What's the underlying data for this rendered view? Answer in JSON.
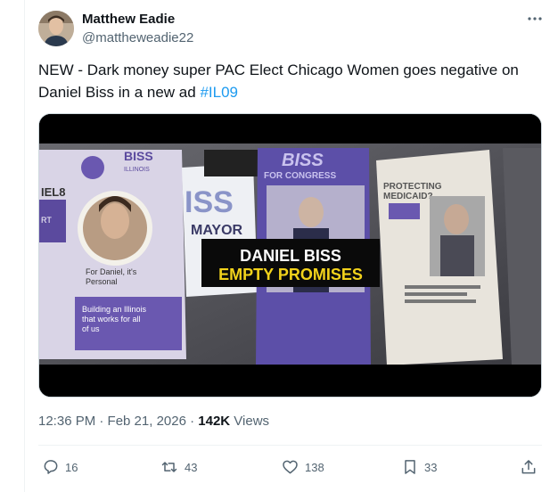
{
  "author": {
    "display_name": "Matthew Eadie",
    "handle": "@mattheweadie22"
  },
  "tweet": {
    "text_main": "NEW - Dark money super PAC Elect Chicago Women goes negative on Daniel Biss in a new ad ",
    "hashtag": "#IL09"
  },
  "media": {
    "caption_line1": "DANIEL BISS",
    "caption_line2": "EMPTY PROMISES",
    "flyer_left": {
      "biss": "BISS",
      "illinois": "ILLINOIS",
      "text1": "For Daniel, it's",
      "text2": "Personal",
      "text3": "Building an Illinois",
      "text4": "that works for all",
      "text5": "of us",
      "edge": "IEL8",
      "edge2": "RT"
    },
    "flyer_mid": {
      "iss": "ISS",
      "mayor": "MAYOR"
    },
    "flyer_congress": {
      "biss": "BISS",
      "for_congress": "FOR CONGRESS"
    },
    "flyer_right": {
      "line1": "PROTECTING",
      "line2": "MEDICAID?"
    }
  },
  "meta": {
    "time": "12:36 PM · Feb 21, 2026 · ",
    "views_count": "142K",
    "views_label": " Views"
  },
  "actions": {
    "replies": "16",
    "reposts": "43",
    "likes": "138",
    "bookmarks": "33"
  },
  "colors": {
    "link": "#1d9bf0",
    "secondary": "#536471",
    "purple": "#5b4a9e"
  }
}
